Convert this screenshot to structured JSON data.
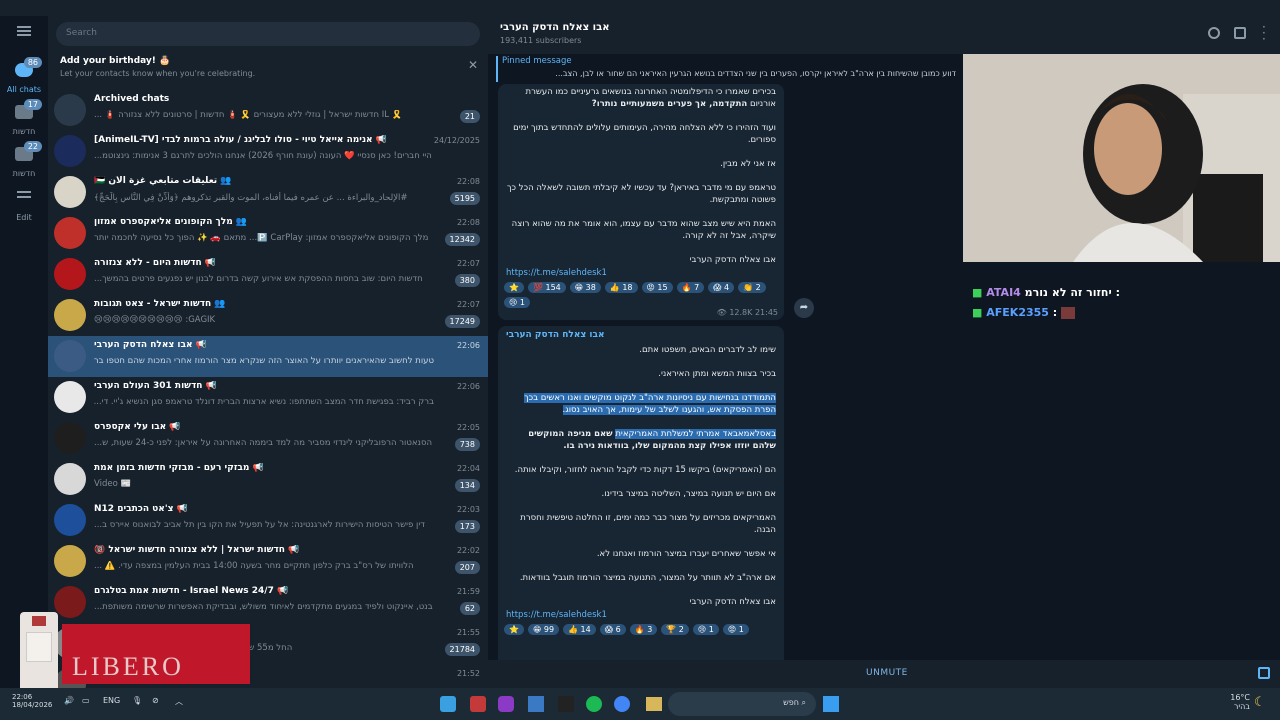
{
  "sidebar": {
    "items": [
      {
        "label": "All chats",
        "badge": "86",
        "icon": "chat-bubbles-icon"
      },
      {
        "label": "חדשות",
        "badge": "17",
        "icon": "folder-icon"
      },
      {
        "label": "חדשות",
        "badge": "22",
        "icon": "folder-icon"
      },
      {
        "label": "Edit",
        "badge": "",
        "icon": "sliders-icon"
      }
    ]
  },
  "search": {
    "placeholder": "Search"
  },
  "birthday": {
    "title": "Add your birthday! 🎂",
    "subtitle": "Let your contacts know when you're celebrating."
  },
  "chats": [
    {
      "name": "Archived chats",
      "preview": "🎗️ IL חדשות ישראל | גוזלי ללא מעצורים 🎗️ 🧯 חדשות | סרטונים ללא צנזורה 🧯 ...",
      "time": "",
      "count": "21",
      "color": "#2b3a4a"
    },
    {
      "name": "📢 אנימה אייאל טיוי - סולו לבליגנ / עולה ברמות לבדי [AnimeIL-TV]",
      "preview": "היי חברים! כאן סנסיי ❤️ העונה (עונת חורף 2026) אנחנו הולכים לתרגם 3 אנימות: גינצוטמ...",
      "time": "24/12/2025",
      "count": "",
      "color": "#1a2b5c"
    },
    {
      "name": "👥 تعليقات متابعي غزة الآن 🇵🇸",
      "preview": "#الإلحاد_والبراءة ... عن عمره فيما أفناه، الموت والقبر تذكروهم ﴿وَأَذِّنْ فِي النَّاسِ بِالْحَجِّ﴾",
      "time": "22:08",
      "count": "5195",
      "color": "#d8d4c8"
    },
    {
      "name": "👥 מלך הקופונים אליאקספרס אמזון",
      "preview": "מלך הקופונים אליאקספרס אמזון: 🅿️ CarPlay... מתאם 🚗 ✨ הפוך כל נסיעה לחכמה יותר",
      "time": "22:08",
      "count": "12342",
      "color": "#c0302a"
    },
    {
      "name": "📢 חדשות היום - ללא צנזורה",
      "preview": "חדשות היום: שוב בחסות ההפסקת אש אירוע קשה בדרום לבנון יש נפגעים פרטים בהמשך...",
      "time": "22:07",
      "count": "380",
      "color": "#b3171c"
    },
    {
      "name": "👥 חדשות ישראל - צאט תגובות",
      "preview": "GAGIK: 😢😢😢😢😢😢😢😢😢😢",
      "time": "22:07",
      "count": "17249",
      "color": "#c9a84a"
    },
    {
      "name": "📢 אבו צאלח הדסק הערבי",
      "preview": "טעות לחשוב שהאיראנים יוותרו על האוצר הזה שנקרא מצר הורמוז אחרי המכות שהם חטפו בר...",
      "time": "22:06",
      "count": "",
      "color": "#3c5b84"
    },
    {
      "name": "📢 חדשות 301 העולם הערבי",
      "preview": "ברק רביד: בפגישת חדר המצב השתתפו: נשיא ארצות הברית דונלד טראמפ סגן הנשיא ג'יי. די...",
      "time": "22:06",
      "count": "",
      "color": "#e8e8e8"
    },
    {
      "name": "📢 אבו עלי אקספרס",
      "preview": "הסנאטור הרפובליקני לינדזי מסביר מה למד ביממה האחרונה על איראן: לפני כ-24 שעות, ש...",
      "time": "22:05",
      "count": "738",
      "color": "#1e1e1e"
    },
    {
      "name": "📢 מבזקי רעם - מבזקי חדשות בזמן אמת",
      "preview": "📰 Video",
      "time": "22:04",
      "count": "134",
      "color": "#d8d8d8"
    },
    {
      "name": "📢 צ'אט הכתבים N12",
      "preview": "דין פישר הטיסות הישירות לארגנטינה: אל על תפעיל את הקו בין תל אביב לבואנוס איירס ב...",
      "time": "22:03",
      "count": "173",
      "color": "#1d4f9a"
    },
    {
      "name": "📢 חדשות ישראל | ללא צנזורה חדשות ישראל 🔞",
      "preview": "הלוויתו של רס\"ב ברק כלפון תתקיים מחר בשעה 14:00 בבית העלמין במצפה עדי. ⚠️ ...",
      "time": "22:02",
      "count": "207",
      "color": "#c9a84a"
    },
    {
      "name": "📢 Israel News 24/7 - חדשות אמת בטלגרם",
      "preview": "בנט, איינקוט ולפיד במגעים מתקדמים לאיחוד משולש, ובבדיקת האפשרות שרשימה משותפת...",
      "time": "21:59",
      "count": "62",
      "color": "#7a1a1a"
    },
    {
      "name": "",
      "preview": "החל מ55 שקל DMC - תאורת תקרה LED מודרנית 💥",
      "time": "21:55",
      "count": "21784",
      "color": "#888"
    },
    {
      "name": "",
      "preview": "",
      "time": "21:52",
      "count": "",
      "color": "#555"
    }
  ],
  "chat": {
    "title": "אבו צאלח הדסק הערבי",
    "subscribers": "193,411 subscribers",
    "pinned_title": "Pinned message",
    "pinned_text": "דווע כמובן שהשיחות בין ארה\"ב לאיראן יקרסו, הפערים בין שני הצדדים בנושא הגרעין האיראני הם שחור או לבן, הצב...",
    "msg1": {
      "p1": "בכירים שאמרו כי הדיפלומטיה האחרונה בנושאים גרעיניים כמו העשרת אורניום",
      "p1b": "התקדמה, אך פערים משמעותיים נותרו?",
      "p2": "ועוד הזהירו כי ללא הצלחה מהירה, העימותים עלולים להתחדש בתוך ימים ספורים.",
      "p3": "אז אני לא מבין.",
      "p4": "טראמפ עם מי מדבר באיראן? עד עכשיו לא קיבלתי תשובה לשאלה הכל כך פשוטה ומתבקשת.",
      "p5": "האמת היא שיש מצב שהוא מדבר עם עצמו, הוא אומר את מה שהוא רוצה שיקרה, אבל זה לא קורה.",
      "sign": "אבו צאלח הדסק הערבי",
      "link": "https://t.me/salehdesk1",
      "reactions": [
        "⭐",
        "💯 154",
        "😁 38",
        "👍 18",
        "😡 15",
        "🔥 7",
        "😱 4",
        "👏 2",
        "😢 1"
      ],
      "views": "12.8K",
      "time": "21:45"
    },
    "msg2": {
      "sender": "אבו צאלח הדסק הערבי",
      "p1": "שימו לב לדברים הבאים, תשפטו אתם.",
      "p2": "בכיר בצוות המשא ומתן האיראני.",
      "p3": "התמודדנו בנחישות עם ניסיונות ארה\"ב לנקוט מוקשים ואנו ראשים בכך הפרת הפסקת אש, והגענו לשלב של עימות, אך האויב נסוג.",
      "p4a": "באסלאמאבאד אמרתי למשלחת האמריקאית",
      "p4b": "שאם מגיפה המוקשים שלהם יוזזו אפילו קצת מהמקום שלו, בוודאות נירה בו.",
      "p5": "הם (האמריקאים) ביקשו 15 דקות כדי לקבל הוראה לחזור, וקיבלו אותה.",
      "p6": "אם היום יש תנועה במיצר, השליטה במיצר בידינו.",
      "p7": "האמריקאים מכריזים על מצור כבר כמה ימים, זו החלטה טיפשית וחסרת הבנה.",
      "p8": "אי אפשר שאחרים יעברו במיצר הורמוז ואנחנו לא.",
      "p9": "אם ארה\"ב לא תוותר על המצור, התנועה במיצר הורמוז תוגבל בוודאות.",
      "sign": "אבו צאלח הדסק הערבי",
      "link": "https://t.me/salehdesk1",
      "reactions": [
        "⭐",
        "😁 99",
        "👍 14",
        "😱 6",
        "🔥 3",
        "🏆 2",
        "😢 1",
        "😡 1"
      ]
    },
    "unmute": "UNMUTE"
  },
  "stream": {
    "line1_name": "ATAI4",
    "line1_text": "יחזור זה לא נורמ :",
    "line2_name": "AFEK2355",
    "line2_text": ":"
  },
  "taskbar": {
    "time": "22:06",
    "date": "18/04/2026",
    "lang": "ENG",
    "search": "חפש",
    "weather": "16°C",
    "weather_desc": "בהיר",
    "ad_text": "LIBERO"
  },
  "colors": {
    "accent": "#5eb5f7",
    "selected": "#2b5278",
    "panel": "#17212b",
    "bg": "#0e1621"
  }
}
